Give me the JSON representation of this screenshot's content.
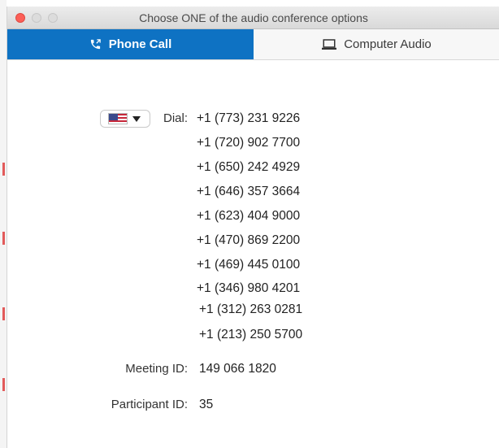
{
  "window": {
    "title": "Choose ONE of the audio conference options"
  },
  "tabs": [
    {
      "label": "Phone Call",
      "icon": "phone-icon",
      "active": true
    },
    {
      "label": "Computer Audio",
      "icon": "laptop-icon",
      "active": false
    }
  ],
  "phone": {
    "country_flag": "us-flag-icon",
    "dial_label": "Dial:",
    "numbers": [
      "+1 (773) 231 9226",
      "+1 (720) 902 7700",
      "+1 (650) 242 4929",
      "+1 (646) 357 3664",
      "+1 (623) 404 9000",
      "+1 (470) 869 2200",
      "+1 (469) 445 0100",
      "+1 (346) 980 4201",
      "+1 (312) 263 0281",
      "+1 (213) 250 5700"
    ],
    "meeting_id_label": "Meeting ID:",
    "meeting_id": "149 066 1820",
    "participant_id_label": "Participant ID:",
    "participant_id": "35"
  },
  "colors": {
    "active_tab": "#0e72c3",
    "close_button": "#fc5f57"
  }
}
